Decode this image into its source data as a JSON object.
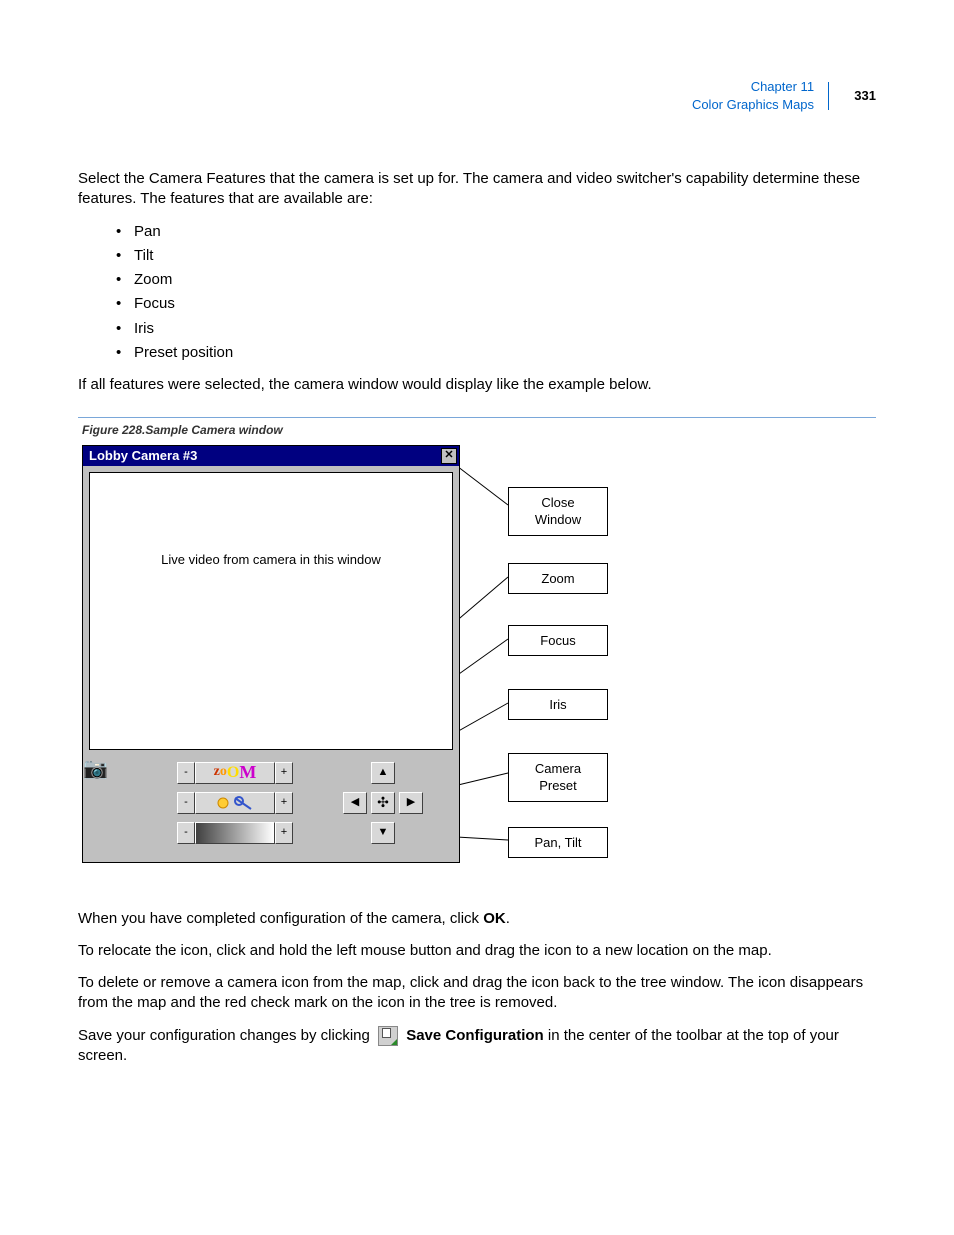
{
  "header": {
    "chapter": "Chapter 11",
    "section": "Color Graphics Maps",
    "page_number": "331"
  },
  "body": {
    "intro": "Select the Camera Features that the camera is set up for. The camera and video switcher's capability determine these features. The features that are available are:",
    "features": [
      "Pan",
      "Tilt",
      "Zoom",
      "Focus",
      "Iris",
      "Preset position"
    ],
    "after_list": "If all features were selected, the camera window would display like the example below.",
    "figure_caption": "Figure 228.Sample Camera window",
    "window": {
      "title": "Lobby Camera #3",
      "viewport_text": "Live video from camera in this window",
      "zoom_word": "zoOM",
      "minus": "-",
      "plus": "+",
      "arrow_up": "▲",
      "arrow_down": "▼",
      "arrow_left": "◀",
      "arrow_right": "▶",
      "preset_glyph": "✣",
      "close_glyph": "✕",
      "camera_glyph": "📷"
    },
    "callouts": {
      "close": "Close\nWindow",
      "zoom": "Zoom",
      "focus": "Focus",
      "iris": "Iris",
      "preset": "Camera\nPreset",
      "pantilt": "Pan, Tilt"
    },
    "p_after_fig_1a": "When you have completed configuration of the camera, click ",
    "p_after_fig_1b": "OK",
    "p_after_fig_1c": ".",
    "p_after_fig_2": "To relocate the icon, click and hold the left mouse button and drag the icon to a new location on the map.",
    "p_after_fig_3": "To delete or remove a camera icon from the map, click and drag the icon back to the tree window. The icon disappears from the map and the red check mark on the icon in the tree is removed.",
    "p_save_a": "Save your configuration changes by clicking ",
    "p_save_b": "Save Configuration",
    "p_save_c": " in the center of the toolbar at the top of your screen."
  }
}
